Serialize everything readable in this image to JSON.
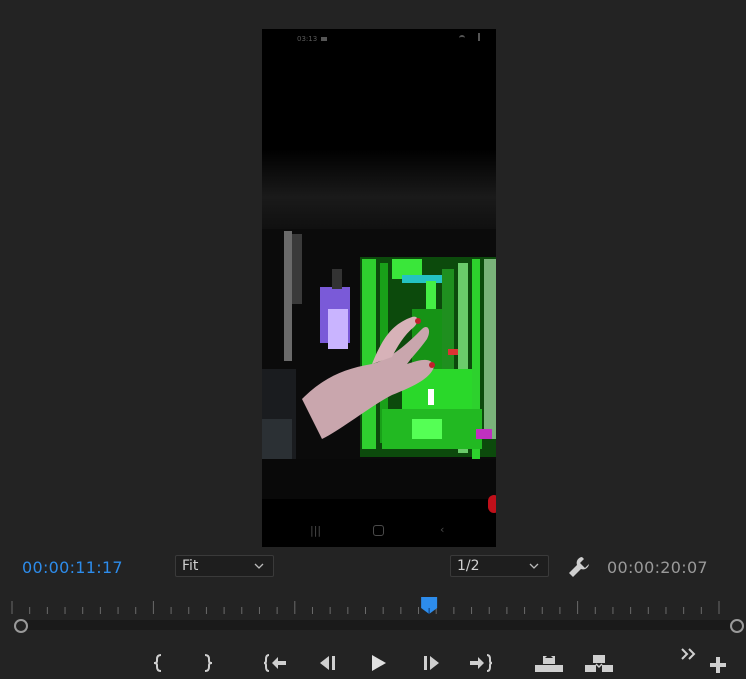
{
  "monitor": {
    "timecode_current": "00:00:11:17",
    "timecode_duration": "00:00:20:07",
    "zoom_select": {
      "value": "Fit"
    },
    "resolution_select": {
      "value": "1/2"
    },
    "playhead_progress": 0.59
  },
  "video": {
    "phone_status_time": "03:13"
  },
  "transport": {
    "buttons": [
      {
        "name": "mark-in-button",
        "icon": "mark-in-icon"
      },
      {
        "name": "mark-out-button",
        "icon": "mark-out-icon"
      },
      {
        "name": "go-to-in-button",
        "icon": "go-to-in-icon"
      },
      {
        "name": "step-back-button",
        "icon": "step-back-icon"
      },
      {
        "name": "play-button",
        "icon": "play-icon"
      },
      {
        "name": "step-forward-button",
        "icon": "step-forward-icon"
      },
      {
        "name": "go-to-out-button",
        "icon": "go-to-out-icon"
      },
      {
        "name": "lift-button",
        "icon": "lift-icon"
      },
      {
        "name": "extract-button",
        "icon": "extract-icon"
      }
    ]
  },
  "colors": {
    "accent": "#2d8ceb",
    "background": "#232323",
    "glitch_green": "#22dd22"
  }
}
